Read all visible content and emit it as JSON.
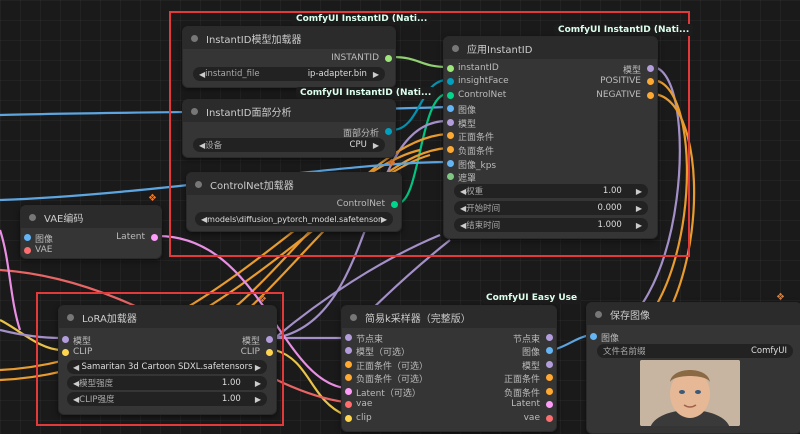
{
  "colors": {
    "model": "#b39ddb",
    "clip": "#ffd54f",
    "vae": "#ff6e6e",
    "latent": "#ff9cf9",
    "conditioning": "#ffa931",
    "image": "#64b5f6",
    "controlnet": "#00d78d",
    "instantid": "#9ee57c",
    "mask": "#81c784",
    "red_box": "#e23a3a"
  },
  "nodes": {
    "instantid_loader": {
      "badge": "ComfyUI InstantID (Nati...",
      "title": "InstantID模型加载器",
      "outputs": [
        "INSTANTID"
      ],
      "widgets": [
        {
          "label": "instantid_file",
          "value": "ip-adapter.bin"
        }
      ]
    },
    "apply_instantid": {
      "badge": "ComfyUI InstantID (Nati...",
      "title": "应用InstantID",
      "inputs": [
        "instantID",
        "insightFace",
        "ControlNet",
        "图像",
        "模型",
        "正面条件",
        "负面条件",
        "图像_kps",
        "遮罩"
      ],
      "outputs": [
        "模型",
        "POSITIVE",
        "NEGATIVE"
      ],
      "widgets": [
        {
          "label": "权重",
          "value": "1.00"
        },
        {
          "label": "开始时间",
          "value": "0.000"
        },
        {
          "label": "结束时间",
          "value": "1.000"
        }
      ]
    },
    "face_analysis": {
      "badge": "ComfyUI InstantID (Nati...",
      "title": "InstantID面部分析",
      "outputs": [
        "面部分析"
      ],
      "widgets": [
        {
          "label": "设备",
          "value": "CPU"
        }
      ]
    },
    "controlnet_loader": {
      "title": "ControlNet加载器",
      "outputs": [
        "ControlNet"
      ],
      "widgets": [
        {
          "label": "",
          "value": "models\\diffusion_pytorch_model.safetensors"
        }
      ]
    },
    "vae_decode": {
      "title": "VAE编码",
      "inputs": [
        "图像",
        "VAE"
      ],
      "outputs": [
        "Latent"
      ]
    },
    "lora_loader": {
      "title": "LoRA加载器",
      "inputs": [
        "模型",
        "CLIP"
      ],
      "outputs": [
        "模型",
        "CLIP"
      ],
      "widgets": [
        {
          "label": "",
          "value": "Samaritan 3d Cartoon SDXL.safetensors"
        },
        {
          "label": "模型强度",
          "value": "1.00"
        },
        {
          "label": "CLIP强度",
          "value": "1.00"
        }
      ]
    },
    "ksampler": {
      "badge": "ComfyUI Easy Use",
      "title": "简易k采样器（完整版）",
      "inputs": [
        "节点束",
        "模型（可选）",
        "正面条件（可选）",
        "负面条件（可选）",
        "Latent（可选）",
        "vae",
        "clip"
      ],
      "outputs": [
        "节点束",
        "图像",
        "模型",
        "正面条件",
        "负面条件",
        "Latent",
        "vae"
      ]
    },
    "save_image": {
      "title": "保存图像",
      "inputs": [
        "图像"
      ],
      "widgets": [
        {
          "label": "文件名前缀",
          "value": "ComfyUI"
        }
      ]
    }
  }
}
